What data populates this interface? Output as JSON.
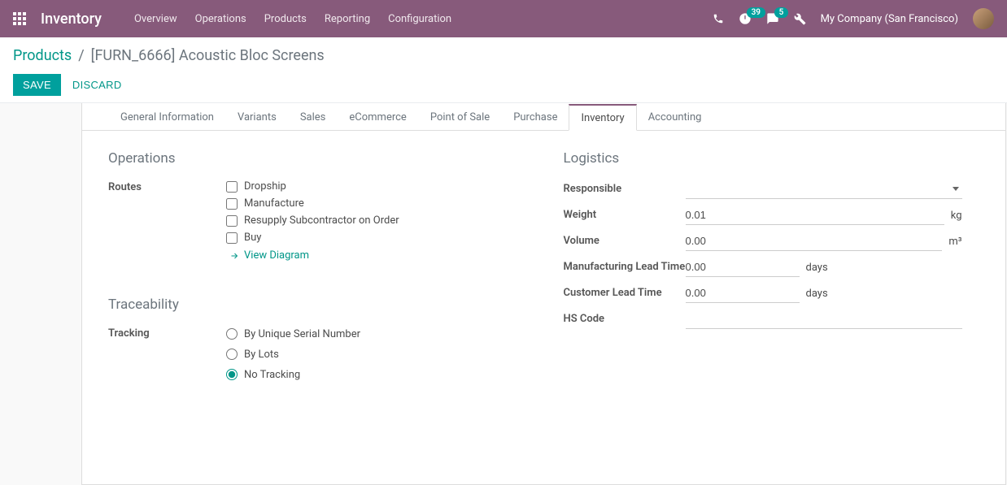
{
  "navbar": {
    "brand": "Inventory",
    "menu": [
      "Overview",
      "Operations",
      "Products",
      "Reporting",
      "Configuration"
    ],
    "activities_count": "39",
    "messages_count": "5",
    "company": "My Company (San Francisco)"
  },
  "breadcrumb": {
    "parent": "Products",
    "current": "[FURN_6666] Acoustic Bloc Screens"
  },
  "actions": {
    "save": "SAVE",
    "discard": "DISCARD"
  },
  "tabs": [
    "General Information",
    "Variants",
    "Sales",
    "eCommerce",
    "Point of Sale",
    "Purchase",
    "Inventory",
    "Accounting"
  ],
  "active_tab": "Inventory",
  "operations": {
    "title": "Operations",
    "routes_label": "Routes",
    "routes": [
      {
        "label": "Dropship",
        "checked": false
      },
      {
        "label": "Manufacture",
        "checked": false
      },
      {
        "label": "Resupply Subcontractor on Order",
        "checked": false
      },
      {
        "label": "Buy",
        "checked": false
      }
    ],
    "view_diagram": "View Diagram"
  },
  "traceability": {
    "title": "Traceability",
    "tracking_label": "Tracking",
    "options": [
      {
        "label": "By Unique Serial Number",
        "value": "serial"
      },
      {
        "label": "By Lots",
        "value": "lots"
      },
      {
        "label": "No Tracking",
        "value": "none"
      }
    ],
    "selected": "none"
  },
  "logistics": {
    "title": "Logistics",
    "responsible_label": "Responsible",
    "responsible_value": "",
    "weight_label": "Weight",
    "weight_value": "0.01",
    "weight_unit": "kg",
    "volume_label": "Volume",
    "volume_value": "0.00",
    "volume_unit": "m³",
    "mfg_lead_label": "Manufacturing Lead Time",
    "mfg_lead_value": "0.00",
    "mfg_lead_unit": "days",
    "cust_lead_label": "Customer Lead Time",
    "cust_lead_value": "0.00",
    "cust_lead_unit": "days",
    "hs_label": "HS Code",
    "hs_value": ""
  }
}
